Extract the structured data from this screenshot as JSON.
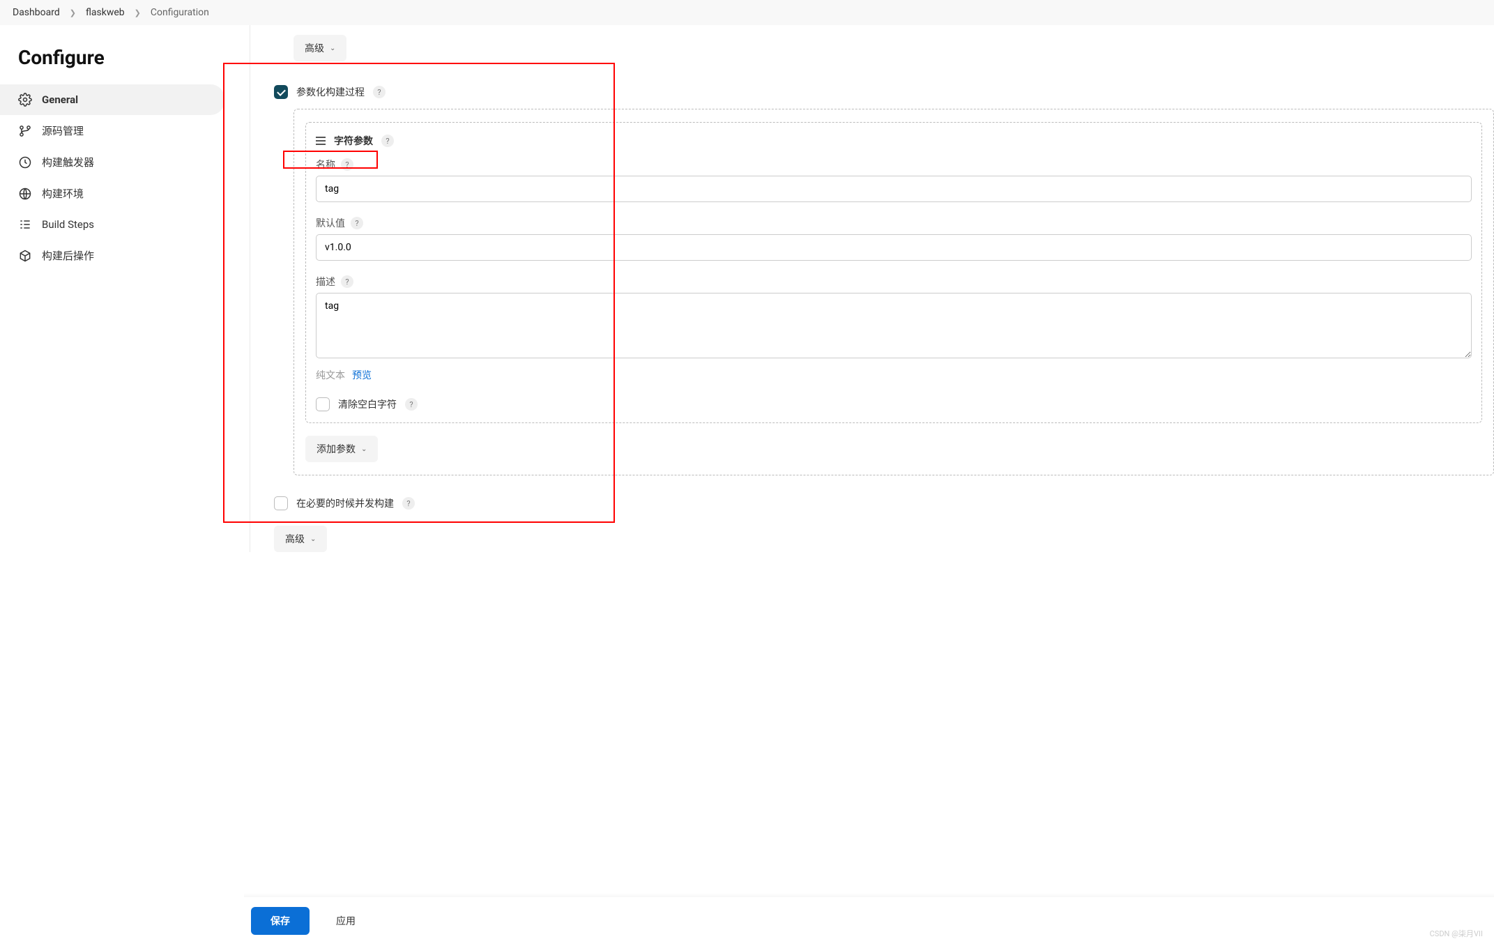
{
  "breadcrumb": {
    "items": [
      "Dashboard",
      "flaskweb",
      "Configuration"
    ]
  },
  "sidebar": {
    "title": "Configure",
    "items": [
      {
        "label": "General"
      },
      {
        "label": "源码管理"
      },
      {
        "label": "构建触发器"
      },
      {
        "label": "构建环境"
      },
      {
        "label": "Build Steps"
      },
      {
        "label": "构建后操作"
      }
    ]
  },
  "main": {
    "advanced_btn_top": "高级",
    "parameterize": {
      "label": "参数化构建过程",
      "param_type": "字符参数",
      "name_label": "名称",
      "name_value": "tag",
      "default_label": "默认值",
      "default_value": "v1.0.0",
      "desc_label": "描述",
      "desc_value": "tag",
      "plaintext": "纯文本",
      "preview": "预览",
      "trim_label": "清除空白字符",
      "add_param": "添加参数"
    },
    "concurrent_label": "在必要的时候并发构建",
    "advanced_btn_bottom": "高级"
  },
  "footer": {
    "save": "保存",
    "apply": "应用"
  },
  "watermark": "CSDN @柒月VII"
}
